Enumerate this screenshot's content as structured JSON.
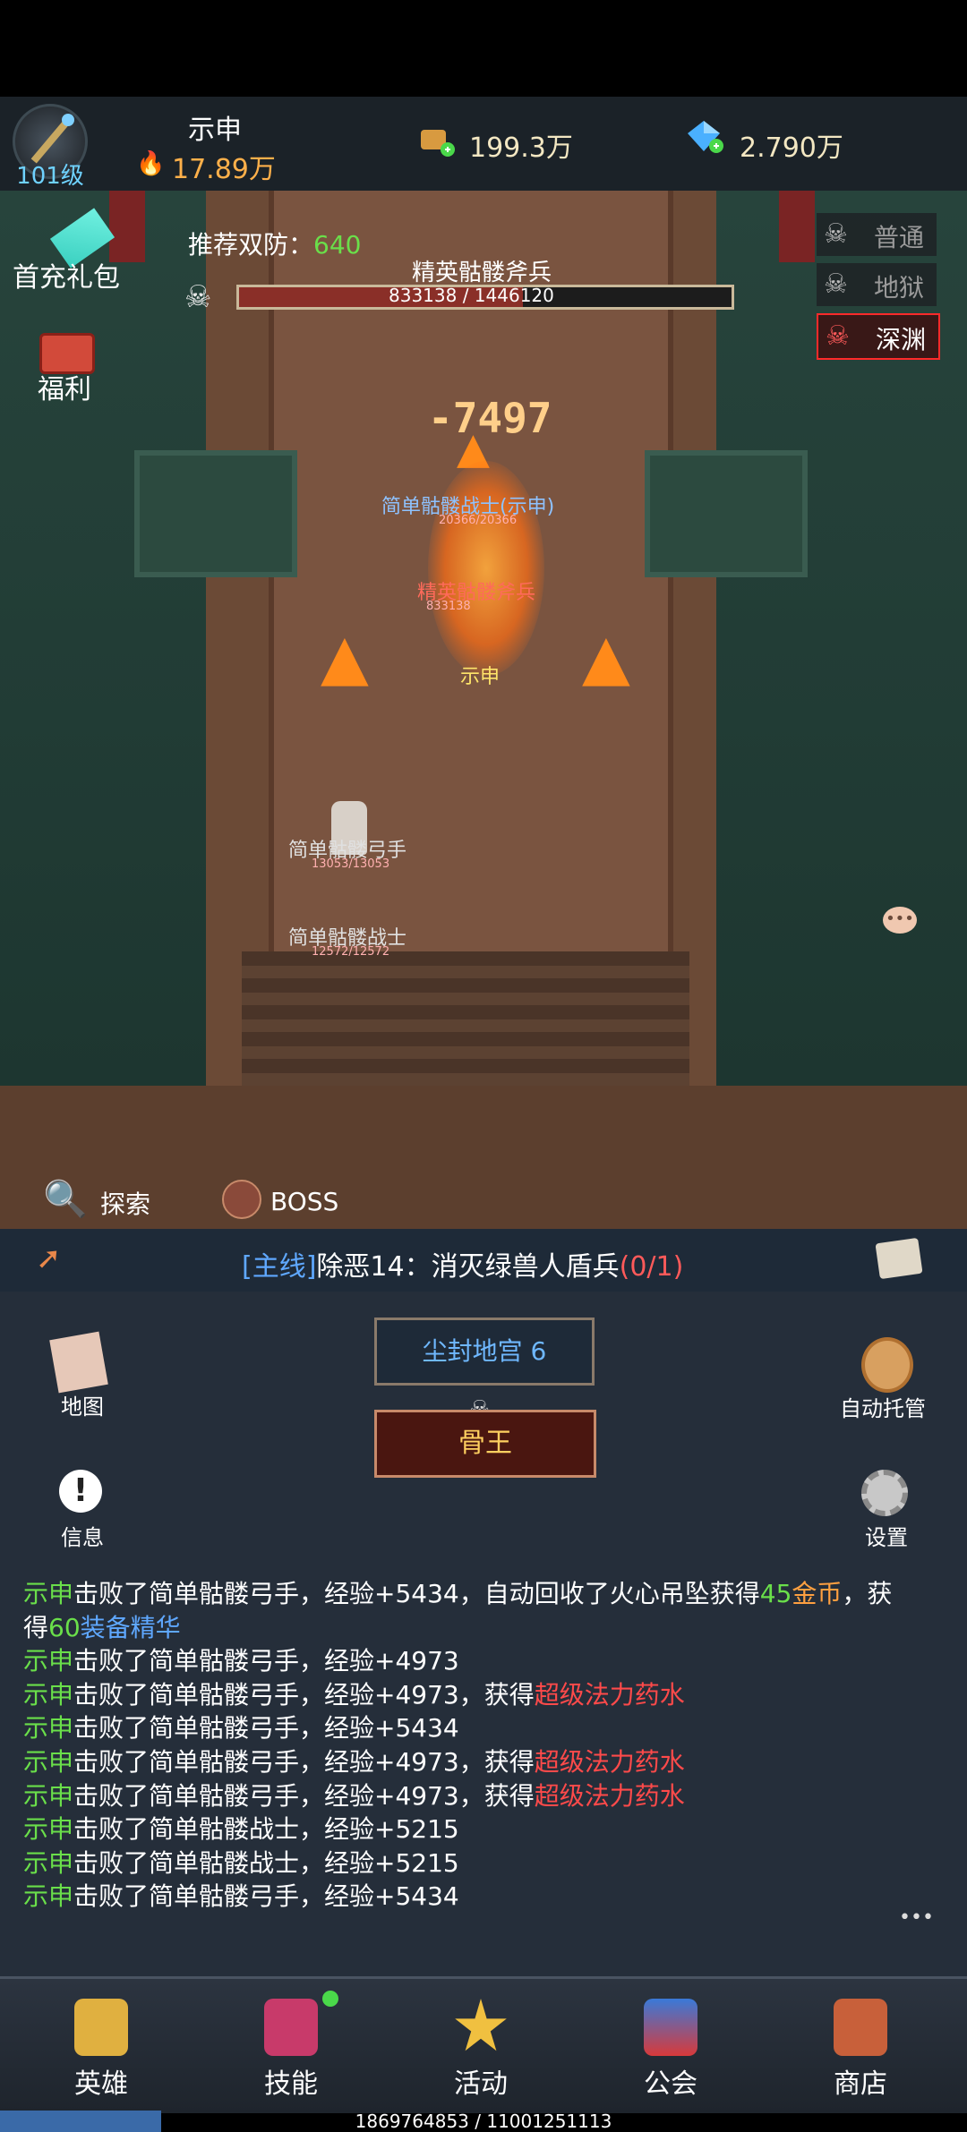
{
  "player": {
    "level": "101级",
    "name": "示申",
    "power": "17.89万"
  },
  "currency": {
    "gold": "199.3万",
    "gems": "2.790万"
  },
  "side_menu": {
    "gift": "首充礼包",
    "welfare": "福利"
  },
  "boss": {
    "recommended_label": "推荐双防：",
    "recommended_value": "640",
    "name": "精英骷髅斧兵",
    "hp_text": "833138 / 1446120",
    "hp_current": 833138,
    "hp_max": 1446120
  },
  "difficulty": {
    "normal": "普通",
    "hell": "地狱",
    "abyss": "深渊",
    "selected": "深渊"
  },
  "scene": {
    "units": [
      {
        "name": "简单骷髅战士(示申)",
        "hp": "20366/20366",
        "color": "blue"
      },
      {
        "name": "精英骷髅斧兵",
        "hp": "833138",
        "color": "red"
      },
      {
        "name": "示申",
        "hp": "",
        "color": "yellow"
      },
      {
        "name": "简单骷髅弓手",
        "hp": "13053/13053",
        "color": "grey"
      },
      {
        "name": "简单骷髅战士",
        "hp": "12572/12572",
        "color": "grey"
      }
    ],
    "damage": "-7497"
  },
  "actions": {
    "explore": "探索",
    "boss": "BOSS"
  },
  "quest": {
    "tag": "[主线]",
    "text": "除恶14：消灭绿兽人盾兵",
    "progress": "(0/1)"
  },
  "panel": {
    "map": "地图",
    "info": "信息",
    "auto": "自动托管",
    "settings": "设置",
    "location": "尘封地宫 6",
    "boss_challenge": "骨王"
  },
  "log": {
    "line1_a": "示申",
    "line1_b": "击败了简单骷髅弓手，经验+5434，自动回收了火心吊坠获得",
    "line1_c": "45",
    "line1_d": "金币",
    "line1_e": "，获",
    "line2_a": "得",
    "line2_b": "60",
    "line2_c": "装备精华",
    "line3_a": "示申",
    "line3_b": "击败了简单骷髅弓手，经验+4973",
    "line4_a": "示申",
    "line4_b": "击败了简单骷髅弓手，经验+4973，获得",
    "line4_c": "超级法力药水",
    "line5_a": "示申",
    "line5_b": "击败了简单骷髅弓手，经验+5434",
    "line6_a": "示申",
    "line6_b": "击败了简单骷髅弓手，经验+4973，获得",
    "line6_c": "超级法力药水",
    "line7_a": "示申",
    "line7_b": "击败了简单骷髅弓手，经验+4973，获得",
    "line7_c": "超级法力药水",
    "line8_a": "示申",
    "line8_b": "击败了简单骷髅战士，经验+5215",
    "line9_a": "示申",
    "line9_b": "击败了简单骷髅战士，经验+5215",
    "line10_a": "示申",
    "line10_b": "击败了简单骷髅弓手，经验+5434",
    "more": "•••"
  },
  "nav": {
    "hero": "英雄",
    "skill": "技能",
    "activity": "活动",
    "guild": "公会",
    "shop": "商店"
  },
  "footer": "1869764853 / 11001251113",
  "colors": {
    "accent_green": "#6adf4a",
    "accent_red": "#ff4a4a",
    "accent_blue": "#5fa8ff",
    "gold": "#ffa040"
  }
}
